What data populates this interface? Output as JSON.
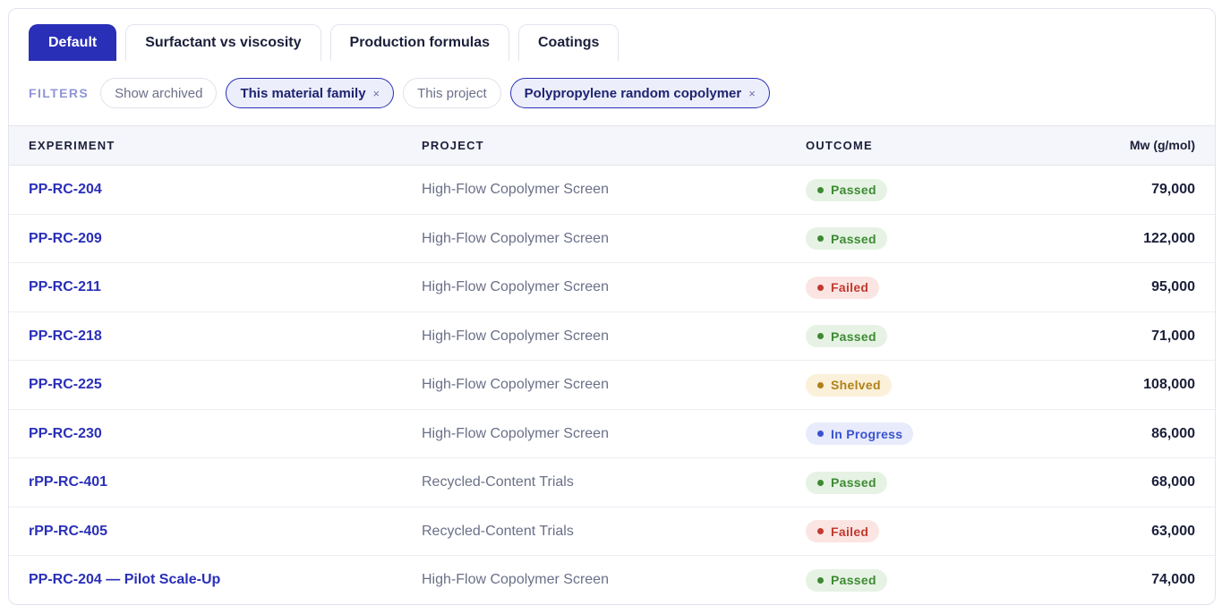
{
  "tabs": [
    {
      "label": "Default",
      "active": true
    },
    {
      "label": "Surfactant vs viscosity",
      "active": false
    },
    {
      "label": "Production formulas",
      "active": false
    },
    {
      "label": "Coatings",
      "active": false
    }
  ],
  "filters": {
    "label": "FILTERS",
    "chips": [
      {
        "label": "Show archived",
        "active": false,
        "remove": ""
      },
      {
        "label": "This material family",
        "active": true,
        "remove": "×"
      },
      {
        "label": "This project",
        "active": false,
        "remove": ""
      },
      {
        "label": "Polypropylene random copolymer",
        "active": true,
        "remove": "×"
      }
    ]
  },
  "table": {
    "columns": [
      "EXPERIMENT",
      "PROJECT",
      "OUTCOME",
      "Mw (g/mol)"
    ],
    "rows": [
      {
        "experiment": "PP-RC-204",
        "project": "High-Flow Copolymer Screen",
        "outcome": "Passed",
        "status": "passed",
        "mw": "79,000"
      },
      {
        "experiment": "PP-RC-209",
        "project": "High-Flow Copolymer Screen",
        "outcome": "Passed",
        "status": "passed",
        "mw": "122,000"
      },
      {
        "experiment": "PP-RC-211",
        "project": "High-Flow Copolymer Screen",
        "outcome": "Failed",
        "status": "failed",
        "mw": "95,000"
      },
      {
        "experiment": "PP-RC-218",
        "project": "High-Flow Copolymer Screen",
        "outcome": "Passed",
        "status": "passed",
        "mw": "71,000"
      },
      {
        "experiment": "PP-RC-225",
        "project": "High-Flow Copolymer Screen",
        "outcome": "Shelved",
        "status": "shelved",
        "mw": "108,000"
      },
      {
        "experiment": "PP-RC-230",
        "project": "High-Flow Copolymer Screen",
        "outcome": "In Progress",
        "status": "progress",
        "mw": "86,000"
      },
      {
        "experiment": "rPP-RC-401",
        "project": "Recycled-Content Trials",
        "outcome": "Passed",
        "status": "passed",
        "mw": "68,000"
      },
      {
        "experiment": "rPP-RC-405",
        "project": "Recycled-Content Trials",
        "outcome": "Failed",
        "status": "failed",
        "mw": "63,000"
      },
      {
        "experiment": "PP-RC-204 — Pilot Scale-Up",
        "project": "High-Flow Copolymer Screen",
        "outcome": "Passed",
        "status": "passed",
        "mw": "74,000"
      }
    ]
  },
  "colors": {
    "accent": "#2a2fb8",
    "passed": "#3d8a33",
    "failed": "#c23a2f",
    "shelved": "#b0811a",
    "in_progress": "#3a52d0"
  }
}
